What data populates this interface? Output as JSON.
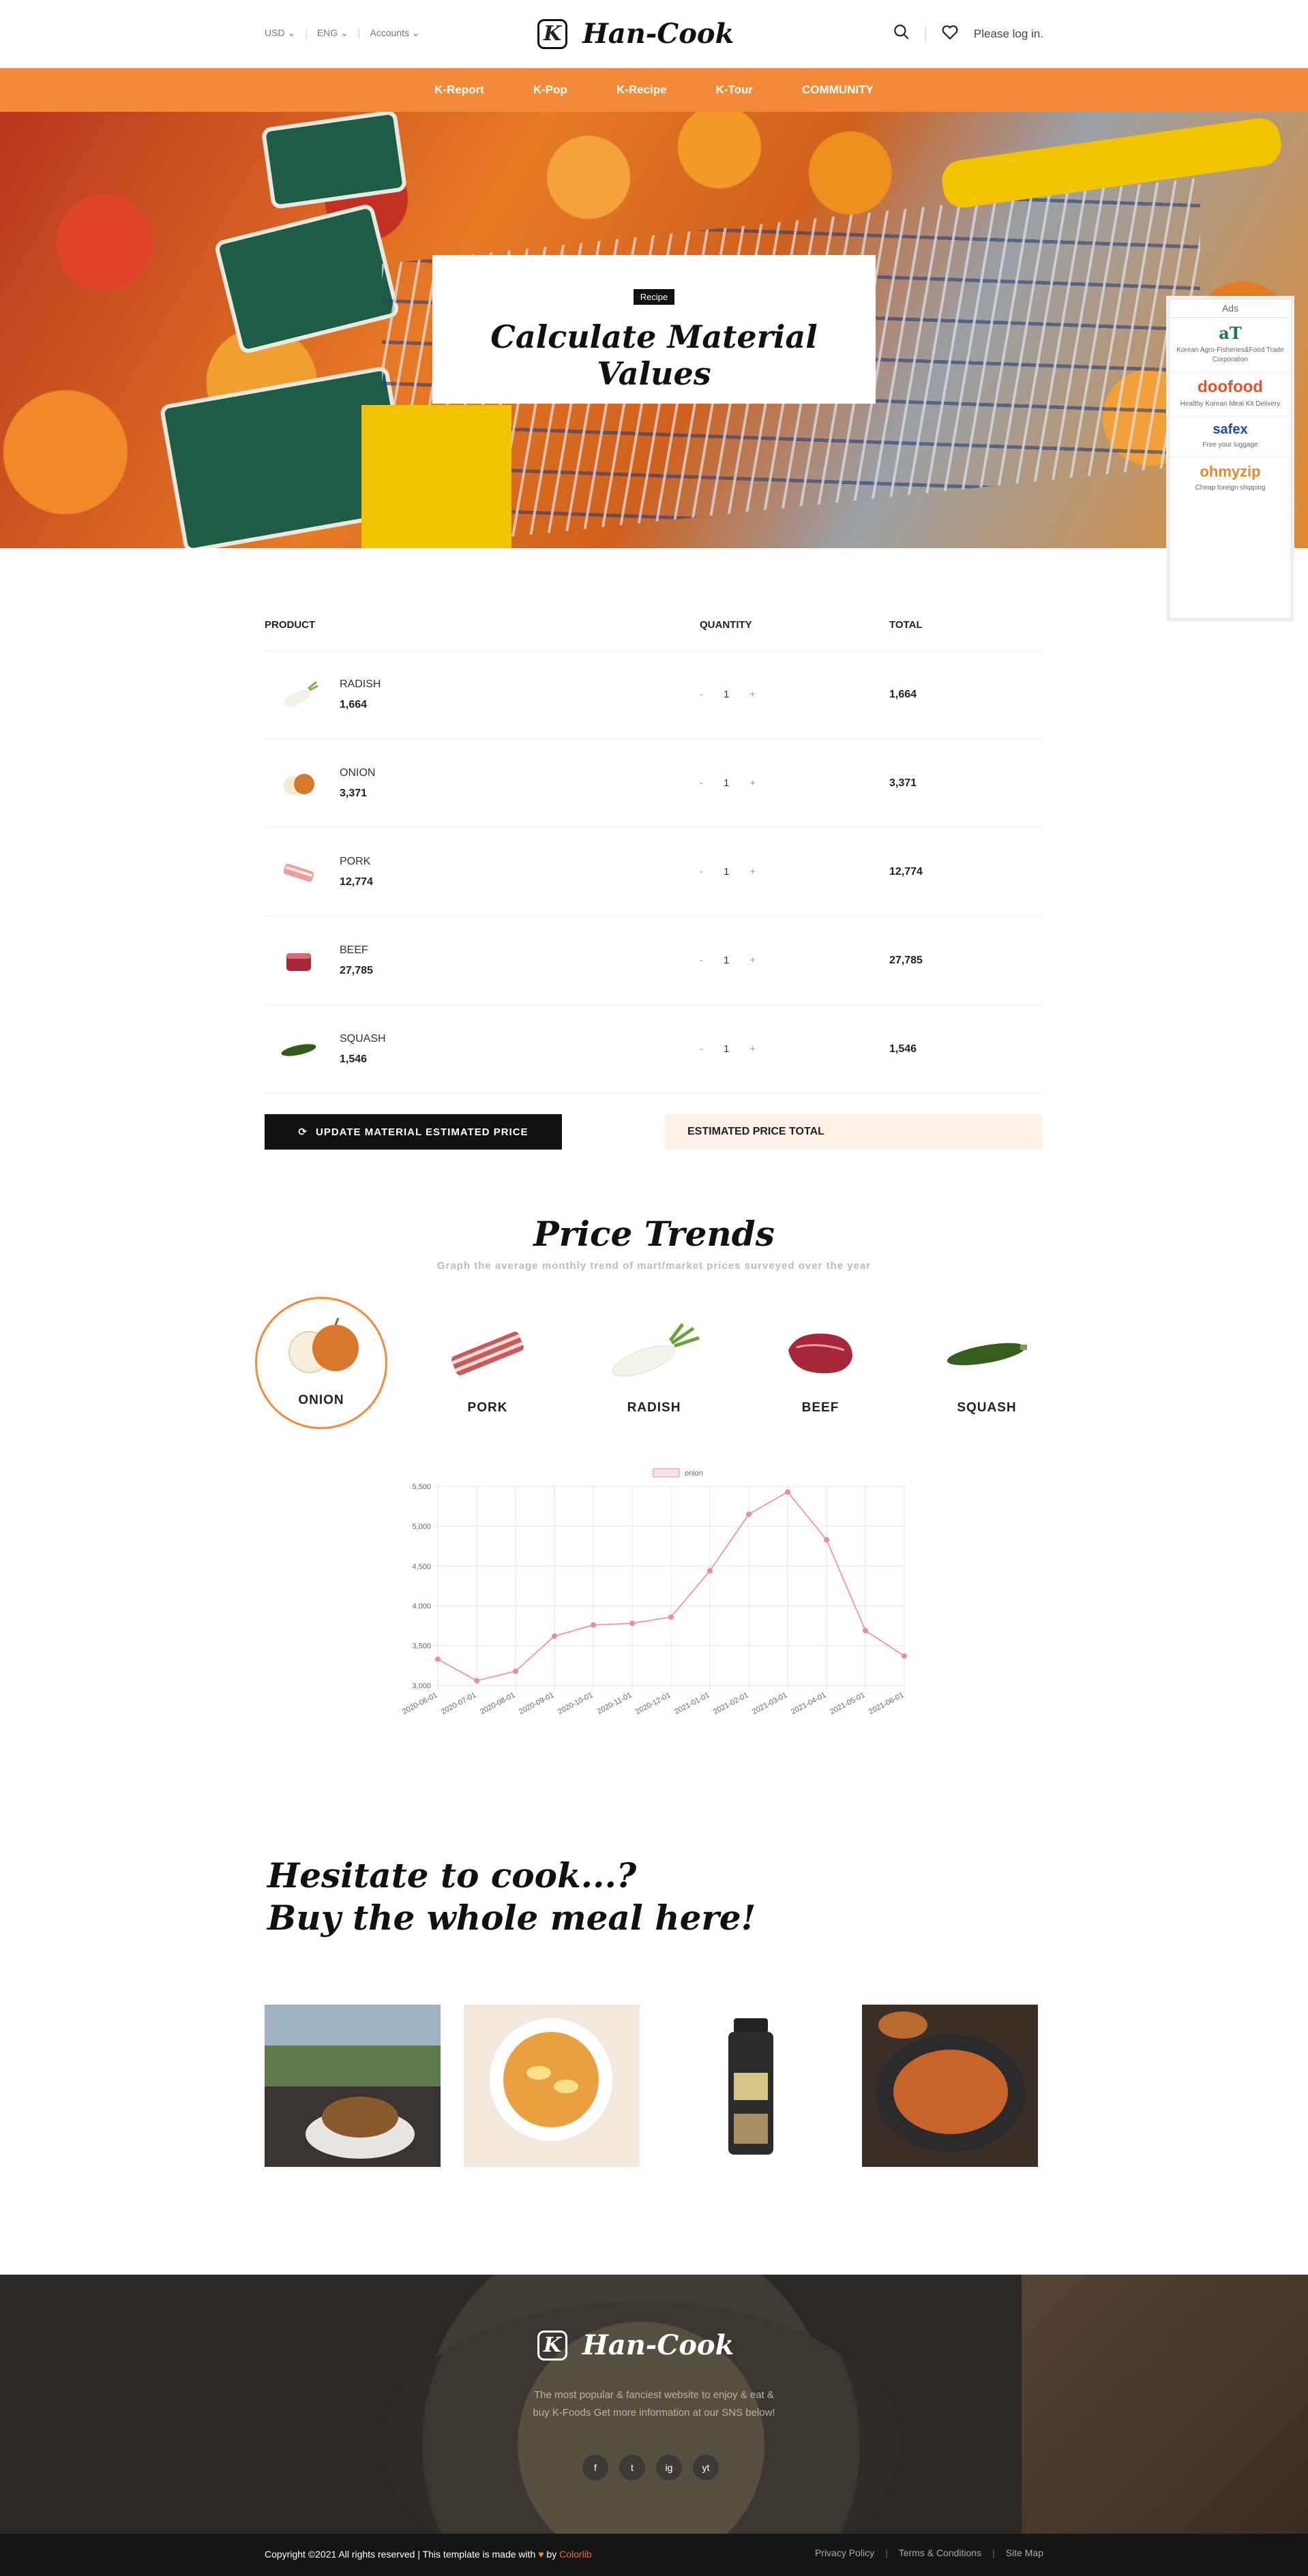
{
  "header": {
    "currency": "USD",
    "language": "ENG",
    "accounts": "Accounts",
    "brand": "Han-Cook",
    "brand_mark": "K",
    "login": "Please log in."
  },
  "nav": [
    "K-Report",
    "K-Pop",
    "K-Recipe",
    "K-Tour",
    "COMMUNITY"
  ],
  "hero": {
    "badge": "Recipe",
    "title": "Calculate Material Values"
  },
  "ads": {
    "title": "Ads",
    "items": [
      {
        "logo": "aT",
        "text": "Korean Agro-Fisheries&Food Trade Corporation"
      },
      {
        "logo": "doofood",
        "text": "Healthy Korean Meal Kit Delivery"
      },
      {
        "logo": "safex",
        "text": "Free your luggage"
      },
      {
        "logo": "ohmyzip",
        "text": "Cheap foreign shipping"
      }
    ]
  },
  "table": {
    "headers": {
      "product": "PRODUCT",
      "quantity": "QUANTITY",
      "total": "TOTAL"
    },
    "rows": [
      {
        "name": "RADISH",
        "price": "1,664",
        "qty": "1",
        "total": "1,664",
        "minus": "-",
        "plus": "+"
      },
      {
        "name": "ONION",
        "price": "3,371",
        "qty": "1",
        "total": "3,371",
        "minus": "-",
        "plus": "+"
      },
      {
        "name": "PORK",
        "price": "12,774",
        "qty": "1",
        "total": "12,774",
        "minus": "-",
        "plus": "+"
      },
      {
        "name": "BEEF",
        "price": "27,785",
        "qty": "1",
        "total": "27,785",
        "minus": "-",
        "plus": "+"
      },
      {
        "name": "SQUASH",
        "price": "1,546",
        "qty": "1",
        "total": "1,546",
        "minus": "-",
        "plus": "+"
      }
    ],
    "update_button": "UPDATE MATERIAL ESTIMATED PRICE",
    "estimated_total": "ESTIMATED PRICE TOTAL"
  },
  "trends": {
    "title": "Price Trends",
    "subtitle": "Graph the average monthly trend of mart/market prices surveyed over the year",
    "items": [
      {
        "label": "ONION",
        "active": true
      },
      {
        "label": "PORK",
        "active": false
      },
      {
        "label": "RADISH",
        "active": false
      },
      {
        "label": "BEEF",
        "active": false
      },
      {
        "label": "SQUASH",
        "active": false
      }
    ]
  },
  "chart_data": {
    "type": "line",
    "x": [
      "2020-06-01",
      "2020-07-01",
      "2020-08-01",
      "2020-09-01",
      "2020-10-01",
      "2020-11-01",
      "2020-12-01",
      "2021-01-01",
      "2021-02-01",
      "2021-03-01",
      "2021-04-01",
      "2021-05-01",
      "2021-06-01"
    ],
    "series": [
      {
        "name": "onion",
        "values": [
          3330,
          3060,
          3180,
          3620,
          3760,
          3780,
          3860,
          4440,
          5150,
          5430,
          4830,
          3690,
          3370
        ],
        "color": "#f08aa0"
      }
    ],
    "yticks": [
      "3,000",
      "3,500",
      "4,000",
      "4,500",
      "5,000",
      "5,500"
    ],
    "ylim": [
      3000,
      5500
    ],
    "grid": true,
    "legend": "top-center"
  },
  "meal": {
    "title_line1": "Hesitate to cook...?",
    "title_line2": "Buy the whole meal here!"
  },
  "footer": {
    "brand": "Han-Cook",
    "brand_mark": "K",
    "text": "The most popular & fanciest website to enjoy & eat & buy K-Foods Get more information at our SNS below!",
    "social": [
      "f",
      "t",
      "ig",
      "yt"
    ],
    "copyright_prefix": "Copyright ©2021 All rights reserved | This template is made with",
    "copyright_by": "by",
    "copyright_brand": "Colorlib",
    "links": [
      "Privacy Policy",
      "Terms & Conditions",
      "Site Map"
    ]
  }
}
